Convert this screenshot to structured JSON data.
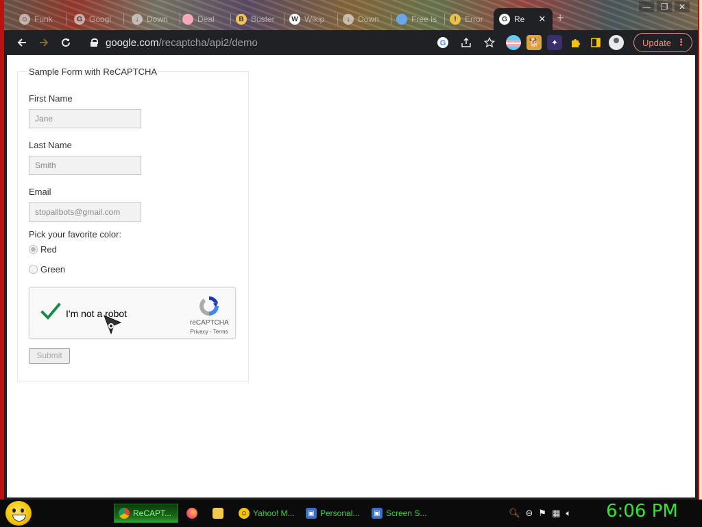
{
  "browser": {
    "tabs": [
      {
        "label": "Funk",
        "icon": "emoji-favicon"
      },
      {
        "label": "Googl",
        "icon": "google-favicon"
      },
      {
        "label": "Down",
        "icon": "download-favicon"
      },
      {
        "label": "Deal",
        "icon": "flag-favicon"
      },
      {
        "label": "Buster",
        "icon": "buster-favicon"
      },
      {
        "label": "Wikip",
        "icon": "wikipedia-favicon"
      },
      {
        "label": "Down",
        "icon": "download-favicon"
      },
      {
        "label": "Free Is",
        "icon": "bottle-favicon"
      },
      {
        "label": "Error",
        "icon": "error-favicon"
      },
      {
        "label": "Re",
        "icon": "google-favicon",
        "active": true
      }
    ],
    "active_tab_close": "✕",
    "new_tab": "+",
    "window_controls": {
      "minimize": "—",
      "maximize": "❐",
      "close": "✕"
    },
    "url_host": "google.com",
    "url_path": "/recaptcha/api2/demo",
    "update_label": "Update",
    "update_menu": "⋮"
  },
  "form": {
    "legend": "Sample Form with ReCAPTCHA",
    "first_name_label": "First Name",
    "first_name_value": "Jane",
    "last_name_label": "Last Name",
    "last_name_value": "Smith",
    "email_label": "Email",
    "email_value": "stopallbots@gmail.com",
    "color_prompt": "Pick your favorite color:",
    "color_options": [
      {
        "label": "Red",
        "checked": true
      },
      {
        "label": "Green",
        "checked": false
      }
    ],
    "submit_label": "Submit"
  },
  "captcha": {
    "label": "I'm not a robot",
    "brand": "reCAPTCHA",
    "links": "Privacy - Terms",
    "checked": true,
    "check_color": "#1a8a4a"
  },
  "taskbar": {
    "items": [
      {
        "label": "ReCAPT...",
        "icon": "chrome-icon",
        "active": true
      },
      {
        "label": "",
        "icon": "firefox-icon"
      },
      {
        "label": "",
        "icon": "folder-icon"
      },
      {
        "label": "Yahoo! M...",
        "icon": "yahoo-messenger-icon"
      },
      {
        "label": "Personal...",
        "icon": "monitor-icon"
      },
      {
        "label": "Screen S...",
        "icon": "monitor-icon"
      }
    ],
    "clock": "6:06 PM",
    "clock_color": "#31e531"
  }
}
